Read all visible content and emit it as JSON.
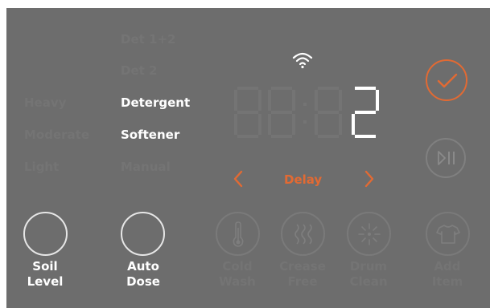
{
  "left_column": {
    "soil_options": [
      "Heavy",
      "Moderate",
      "Light"
    ]
  },
  "detergent_column": {
    "options": [
      "Det 1+2",
      "Det 2",
      "Detergent",
      "Softener",
      "Manual"
    ]
  },
  "display": {
    "inactive_digits": "88:88",
    "value": "2"
  },
  "delay": {
    "label": "Delay",
    "prev_icon": "chevron-left-icon",
    "next_icon": "chevron-right-icon"
  },
  "buttons": {
    "soil_level": "Soil\nLevel",
    "auto_dose": "Auto\nDose",
    "cold_wash": "Cold\nWash",
    "crease_free": "Crease\nFree",
    "drum_clean": "Drum\nClean",
    "add_item": "Add\nItem"
  },
  "status": {
    "wifi_icon": "wifi-icon",
    "confirm_icon": "checkmark-icon",
    "play_pause_icon": "play-pause-icon"
  },
  "colors": {
    "panel": "#6d6d6d",
    "active_text": "#ffffff",
    "inactive_text": "#747474",
    "accent": "#e26a33"
  }
}
